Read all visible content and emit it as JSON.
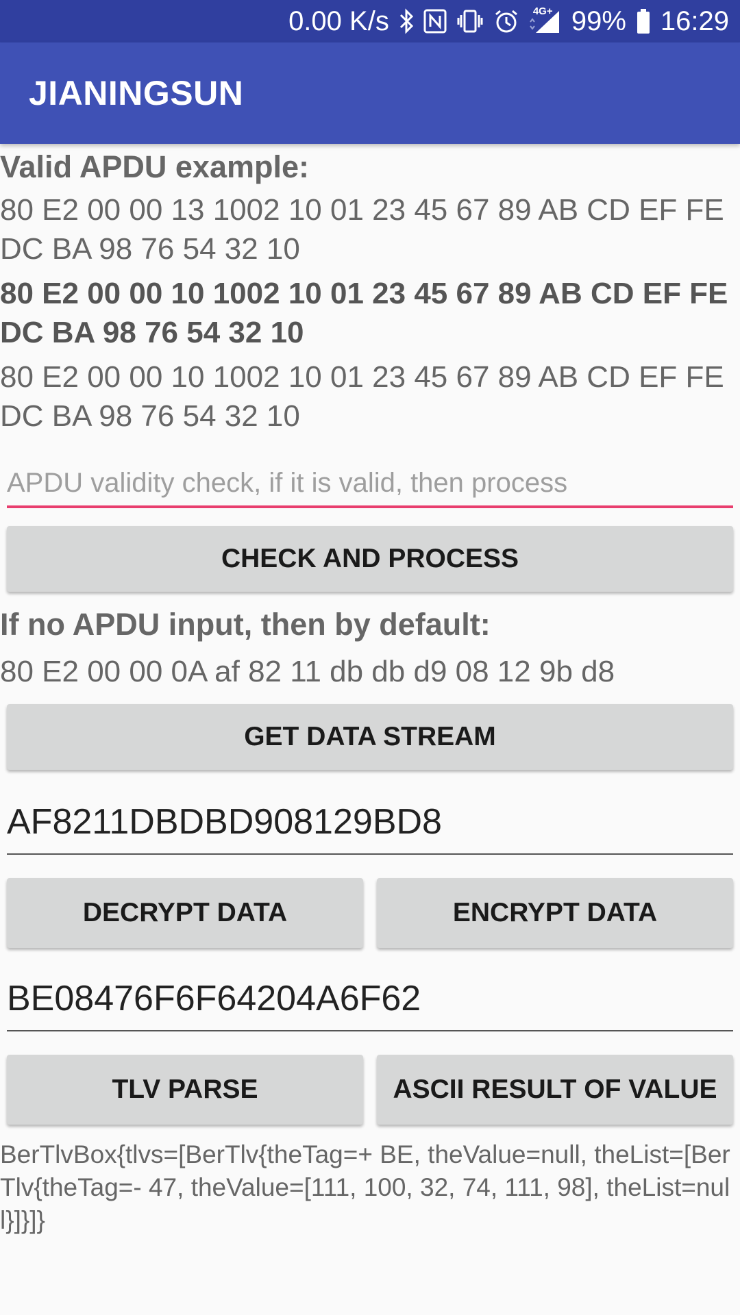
{
  "status_bar": {
    "speed": "0.00 K/s",
    "network": "4G+",
    "battery": "99%",
    "time": "16:29",
    "icons": [
      "bluetooth-icon",
      "nfc-icon",
      "vibrate-icon",
      "alarm-icon",
      "signal-icon",
      "battery-icon"
    ]
  },
  "app_bar": {
    "title": "JIANINGSUN",
    "color": "#3f51b5",
    "status_color": "#303f9f"
  },
  "examples": {
    "heading": "Valid APDU example:",
    "example_1": "80 E2 00 00 13 1002 10 01 23 45 67 89 AB CD EF FE DC BA 98 76 54 32 10",
    "example_2": "80 E2 00 00 10 1002 10 01 23 45 67 89 AB CD EF FE DC BA 98 76 54 32 10",
    "example_3": "80 E2 00 00 10 1002 10 01 23 45 67 89 AB CD EF FE DC BA 98 76 54 32 10"
  },
  "apdu_input": {
    "value": "",
    "placeholder": "APDU validity check, if it is valid, then process",
    "accent": "#e83e6e"
  },
  "buttons": {
    "check_process": "CHECK AND PROCESS",
    "get_data_stream": "GET DATA STREAM",
    "decrypt": "DECRYPT DATA",
    "encrypt": "ENCRYPT DATA",
    "tlv_parse": "TLV PARSE",
    "ascii_result": "ASCII RESULT OF VALUE"
  },
  "default_section": {
    "heading": "If no APDU input, then by default:",
    "apdu": "80 E2 00 00 0A af 82 11 db db d9 08 12 9b d8"
  },
  "data_field": {
    "value": "AF8211DBDBD908129BD8"
  },
  "tlv_field": {
    "value": "BE08476F6F64204A6F62"
  },
  "result": {
    "text": "BerTlvBox{tlvs=[BerTlv{theTag=+ BE, theValue=null, theList=[BerTlv{theTag=- 47, theValue=[111, 100, 32, 74, 111, 98], theList=null}]}]}"
  }
}
